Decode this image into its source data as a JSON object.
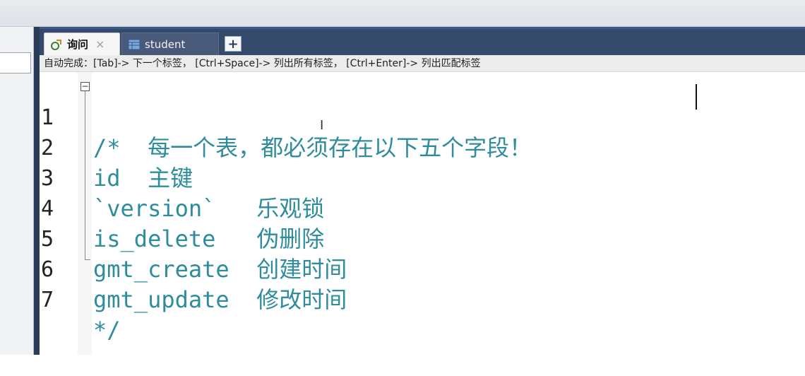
{
  "tabs": [
    {
      "label": "询问",
      "active": true,
      "icon": "query-icon",
      "close": "×"
    },
    {
      "label": "student",
      "active": false,
      "icon": "table-icon"
    }
  ],
  "add_tab_label": "+",
  "hint_text": "自动完成：[Tab]-> 下一个标签， [Ctrl+Space]-> 列出所有标签， [Ctrl+Enter]-> 列出匹配标签",
  "code_lines": [
    {
      "num": "1",
      "text": "/*  每一个表，都必须存在以下五个字段！"
    },
    {
      "num": "2",
      "text": "id  主键"
    },
    {
      "num": "3",
      "text": "`version`   乐观锁"
    },
    {
      "num": "4",
      "text": "is_delete   伪删除"
    },
    {
      "num": "5",
      "text": "gmt_create  创建时间"
    },
    {
      "num": "6",
      "text": "gmt_update  修改时间"
    },
    {
      "num": "7",
      "text": "*/"
    }
  ],
  "colors": {
    "code_text": "#2e8c9c",
    "tabbar": "#344a6b",
    "panel_separator": "#2a3b57"
  }
}
